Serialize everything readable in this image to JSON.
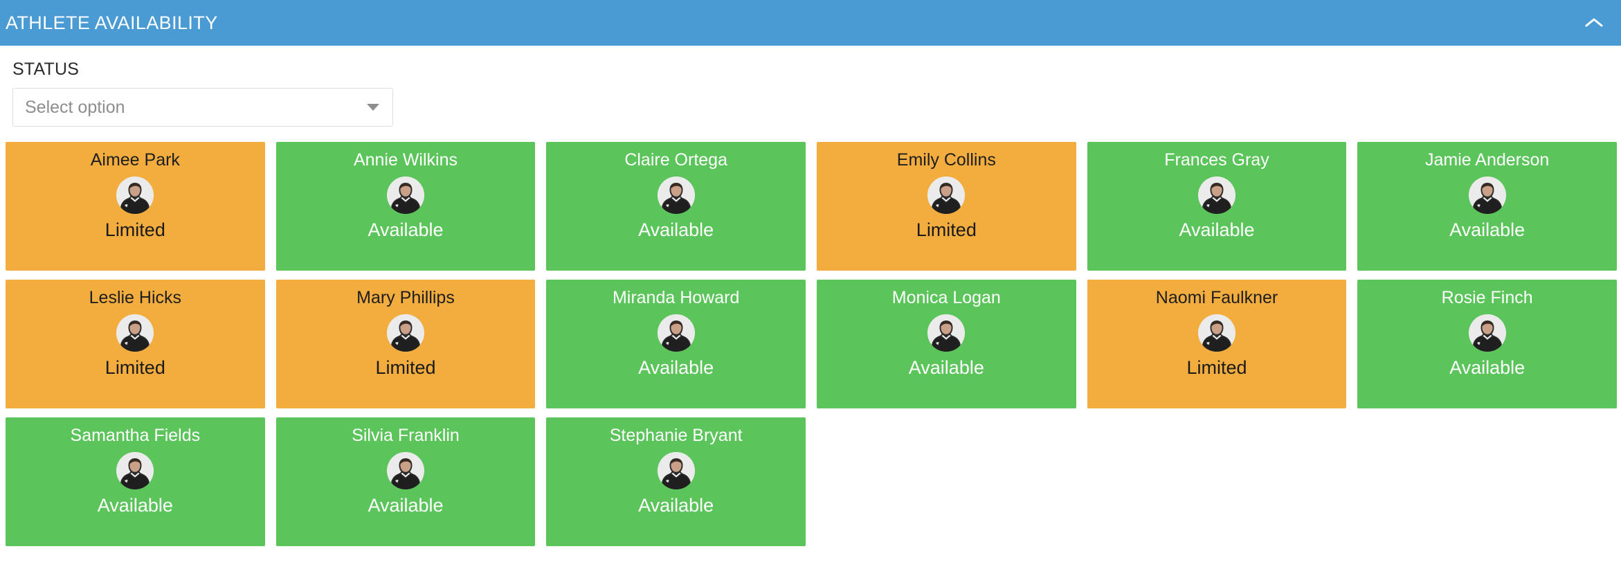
{
  "header": {
    "title": "ATHLETE AVAILABILITY",
    "collapse_icon": "chevron-up-icon",
    "background_color": "#4a9ad4"
  },
  "filter": {
    "label": "STATUS",
    "select_placeholder": "Select option",
    "caret_icon": "chevron-down-icon"
  },
  "colors": {
    "available": "#5bc45a",
    "limited": "#f2ad3e",
    "accent": "#4a9ad4"
  },
  "status_labels": {
    "available": "Available",
    "limited": "Limited"
  },
  "athletes": [
    {
      "name": "Aimee Park",
      "status": "Limited",
      "state": "limited"
    },
    {
      "name": "Annie Wilkins",
      "status": "Available",
      "state": "available"
    },
    {
      "name": "Claire Ortega",
      "status": "Available",
      "state": "available"
    },
    {
      "name": "Emily Collins",
      "status": "Limited",
      "state": "limited"
    },
    {
      "name": "Frances Gray",
      "status": "Available",
      "state": "available"
    },
    {
      "name": "Jamie Anderson",
      "status": "Available",
      "state": "available"
    },
    {
      "name": "Leslie Hicks",
      "status": "Limited",
      "state": "limited"
    },
    {
      "name": "Mary Phillips",
      "status": "Limited",
      "state": "limited"
    },
    {
      "name": "Miranda Howard",
      "status": "Available",
      "state": "available"
    },
    {
      "name": "Monica Logan",
      "status": "Available",
      "state": "available"
    },
    {
      "name": "Naomi Faulkner",
      "status": "Limited",
      "state": "limited"
    },
    {
      "name": "Rosie Finch",
      "status": "Available",
      "state": "available"
    },
    {
      "name": "Samantha Fields",
      "status": "Available",
      "state": "available"
    },
    {
      "name": "Silvia Franklin",
      "status": "Available",
      "state": "available"
    },
    {
      "name": "Stephanie Bryant",
      "status": "Available",
      "state": "available"
    }
  ]
}
